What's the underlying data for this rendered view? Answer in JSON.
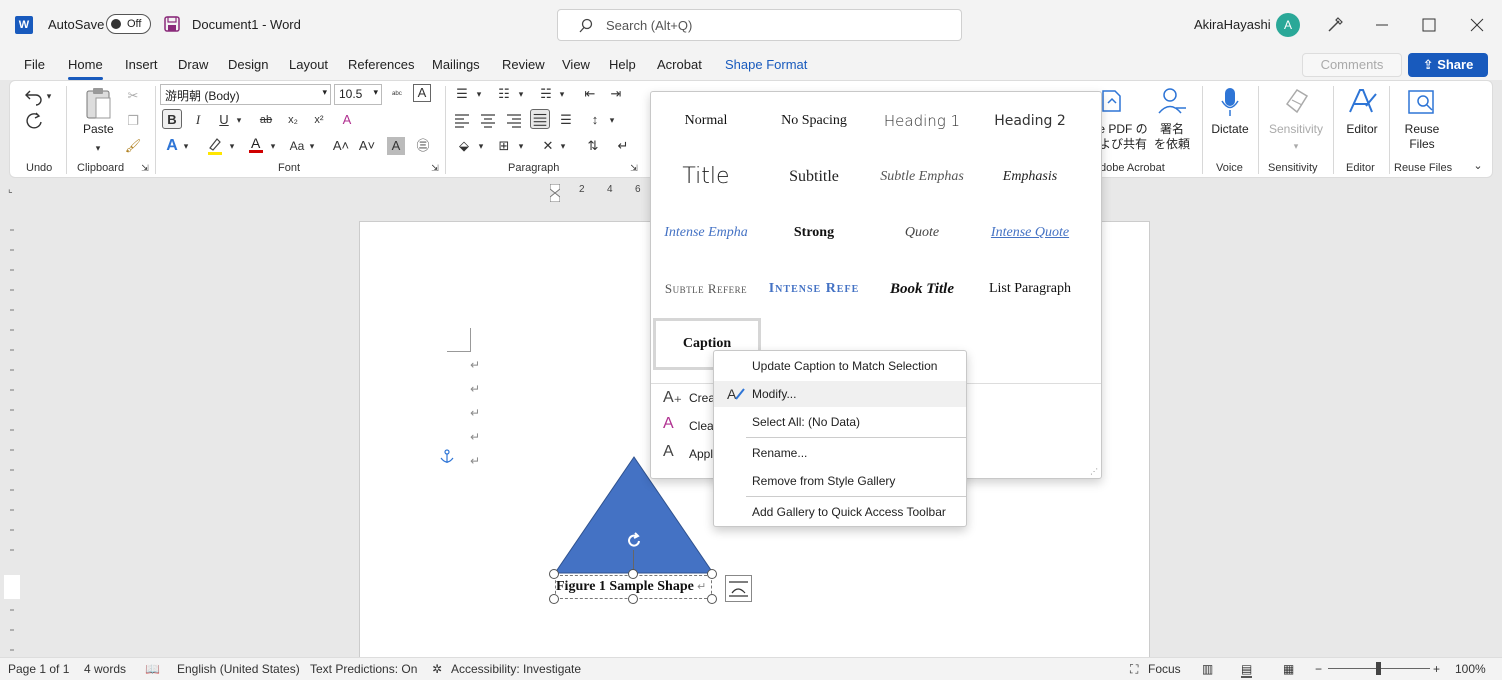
{
  "titlebar": {
    "app_logo": "W",
    "autosave_label": "AutoSave",
    "autosave_state": "Off",
    "document_title": "Document1  -  Word",
    "search_placeholder": "Search (Alt+Q)",
    "user_name": "AkiraHayashi",
    "avatar_initial": "A"
  },
  "tabs": [
    "File",
    "Home",
    "Insert",
    "Draw",
    "Design",
    "Layout",
    "References",
    "Mailings",
    "Review",
    "View",
    "Help",
    "Acrobat",
    "Shape Format"
  ],
  "active_tab": "Home",
  "comments_label": "Comments",
  "share_label": "Share",
  "ribbon": {
    "groups": {
      "undo": "Undo",
      "clipboard": "Clipboard",
      "font": "Font",
      "paragraph": "Paragraph",
      "acrobat": "dobe Acrobat",
      "voice": "Voice",
      "sensitivity": "Sensitivity",
      "editor": "Editor",
      "reuse": "Reuse Files"
    },
    "paste_label": "Paste",
    "font_name": "游明朝 (Body)",
    "font_size": "10.5",
    "acrobat_btn1_line1": "e PDF の",
    "acrobat_btn1_line2": "よび共有",
    "acrobat_btn2_line1": "署名",
    "acrobat_btn2_line2": "を依頼",
    "dictate_label": "Dictate",
    "sensitivity_label": "Sensitivity",
    "editor_label": "Editor",
    "reuse_line1": "Reuse",
    "reuse_line2": "Files"
  },
  "styles_gallery": {
    "rows": [
      [
        "Normal",
        "No Spacing",
        "Heading 1",
        "Heading 2"
      ],
      [
        "Title",
        "Subtitle",
        "Subtle Emphas",
        "Emphasis"
      ],
      [
        "Intense Empha",
        "Strong",
        "Quote",
        "Intense Quote"
      ],
      [
        "Subtle Refere",
        "Intense Refe",
        "Book Title",
        "List Paragraph"
      ],
      [
        "Caption"
      ]
    ],
    "selected": "Caption",
    "actions": [
      "Crea",
      "Clea",
      "Appl"
    ]
  },
  "context_menu": {
    "items": [
      "Update Caption to Match Selection",
      "Modify...",
      "Select All: (No Data)",
      "Rename...",
      "Remove from Style Gallery",
      "Add Gallery to Quick Access Toolbar"
    ],
    "hovered": "Modify..."
  },
  "ruler_numbers": [
    "2",
    "4",
    "6"
  ],
  "document": {
    "caption_text": "Figure 1 Sample Shape",
    "shape_fill": "#4472c4"
  },
  "statusbar": {
    "page": "Page 1 of 1",
    "words": "4 words",
    "language": "English (United States)",
    "predictions": "Text Predictions: On",
    "accessibility": "Accessibility: Investigate",
    "focus": "Focus",
    "zoom": "100%"
  },
  "colors": {
    "accent": "#185abd",
    "shape": "#4472c4"
  }
}
